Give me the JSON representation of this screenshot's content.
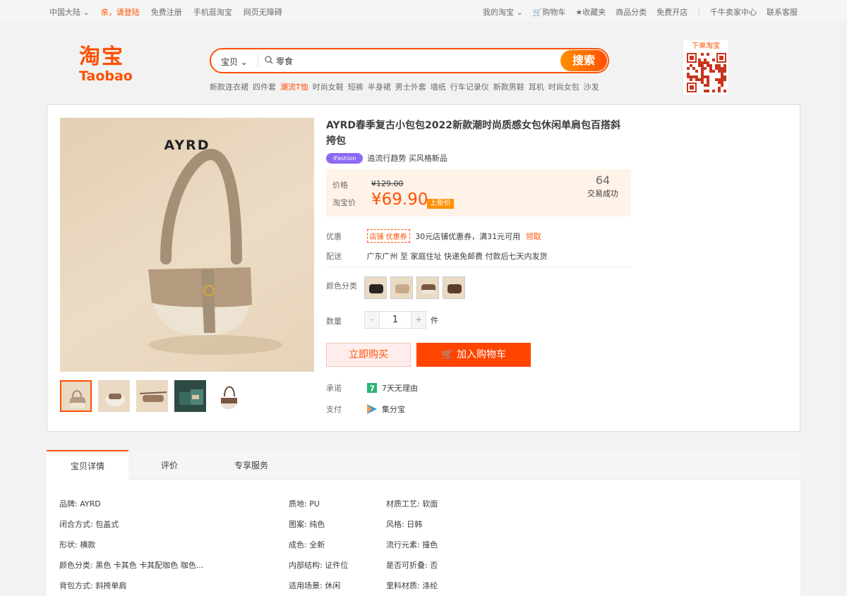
{
  "topbar": {
    "region": "中国大陆",
    "login": "亲，请登陆",
    "register": "免费注册",
    "mobile": "手机逛淘宝",
    "accessible": "网页无障碍",
    "my_taobao": "我的淘宝",
    "cart": "购物车",
    "favorites": "收藏夹",
    "categories": "商品分类",
    "open_store": "免费开店",
    "seller_center": "千牛卖家中心",
    "service": "联系客服"
  },
  "logo": {
    "cn": "淘宝",
    "en": "Taobao"
  },
  "search": {
    "type": "宝贝",
    "value": "零食",
    "button": "搜索",
    "hot": [
      "新款连衣裙",
      "四件套",
      "潮流T恤",
      "时尚女鞋",
      "短裤",
      "半身裙",
      "男士外套",
      "墙纸",
      "行车记录仪",
      "新款男鞋",
      "耳机",
      "时尚女包",
      "沙发"
    ]
  },
  "qr": {
    "label": "下单淘宝"
  },
  "product": {
    "image_brand": "AYRD",
    "title": "AYRD春季复古小包包2022新款潮时尚质感女包休闲单肩包百搭斜挎包",
    "tag": "iFashion",
    "tag_text": "追流行趋势 买风格新品",
    "price_label": "价格",
    "original_price": "¥129.00",
    "taobao_price_label": "淘宝价",
    "price": "¥69.90",
    "price_badge": "上新价",
    "sold_count": "64",
    "sold_label": "交易成功",
    "coupon_label": "优惠",
    "coupon_tag": "店铺 优惠券",
    "coupon_text": "30元店铺优惠券，满31元可用",
    "coupon_link": "领取",
    "shipping_label": "配送",
    "shipping_text": "广东广州 至 家庭住址 快递免邮费 付款后七天内发货",
    "color_label": "颜色分类",
    "qty_label": "数量",
    "qty_minus": "-",
    "qty_value": "1",
    "qty_plus": "+",
    "qty_unit": "件",
    "buy_now": "立即购买",
    "add_cart": "加入购物车",
    "promise_label": "承诺",
    "promise_text": "7天无理由",
    "payment_label": "支付",
    "payment_text": "集分宝"
  },
  "tabs": [
    "宝贝详情",
    "评价",
    "专享服务"
  ],
  "attributes": [
    [
      "品牌: AYRD",
      "质地: PU",
      "材质工艺: 软面"
    ],
    [
      "闭合方式: 包盖式",
      "图案: 纯色",
      "风格: 日韩"
    ],
    [
      "形状: 横款",
      "成色: 全新",
      "流行元素: 撞色"
    ],
    [
      "颜色分类: 黑色 卡其色 卡其配咖色 咖色...",
      "内部结构: 证件位",
      "是否可折叠: 否"
    ],
    [
      "背包方式: 斜挎单肩",
      "适用场景: 休闲",
      "里料材质: 涤纶"
    ]
  ],
  "colors": {
    "accent": "#ff5000",
    "price_bg": "#fff2e8",
    "cart_button": "#ff4400",
    "ifashion": "#8d69f5"
  }
}
